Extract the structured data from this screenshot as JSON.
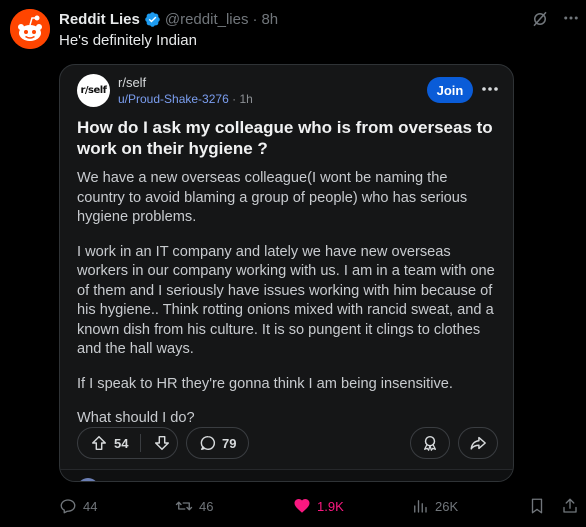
{
  "tweet": {
    "display_name": "Reddit Lies",
    "handle": "@reddit_lies",
    "separator": "·",
    "time": "8h",
    "text": "He's definitely Indian",
    "icons": {
      "avatar": "reddit-snoo-icon",
      "verified": "verified-badge-icon",
      "grok": "grok-icon",
      "more": "more-horizontal-icon"
    },
    "colors": {
      "avatar_bg": "#ff4500",
      "verified": "#1d9bf0",
      "like": "#f91880"
    }
  },
  "card": {
    "subreddit": "r/self",
    "subreddit_avatar_text": "r/self",
    "user": "u/Proud-Shake-3276",
    "separator": "·",
    "time": "1h",
    "join_label": "Join",
    "title": "How do I ask my colleague who is from overseas to work on their hygiene ?",
    "paragraphs": [
      "We have a new overseas colleague(I wont be naming the country to avoid blaming a group of people) who has serious hygiene problems.",
      "I work in an IT company and lately we have new overseas workers in our company working with us. I am in a team with one of them and I seriously have issues working with him because of his hygiene.. Think rotting onions mixed with rancid sweat, and a known dish from his culture. It is so pungent it clings to clothes and the hall ways.",
      "If I speak to HR they're gonna think I am being insensitive.",
      "What should I do?"
    ],
    "votes": "54",
    "comments": "79",
    "colors": {
      "join": "#0a5cd8",
      "link": "#7b9ef0"
    }
  },
  "tweet_actions": {
    "replies": "44",
    "retweets": "46",
    "likes": "1.9K",
    "views": "26K"
  }
}
